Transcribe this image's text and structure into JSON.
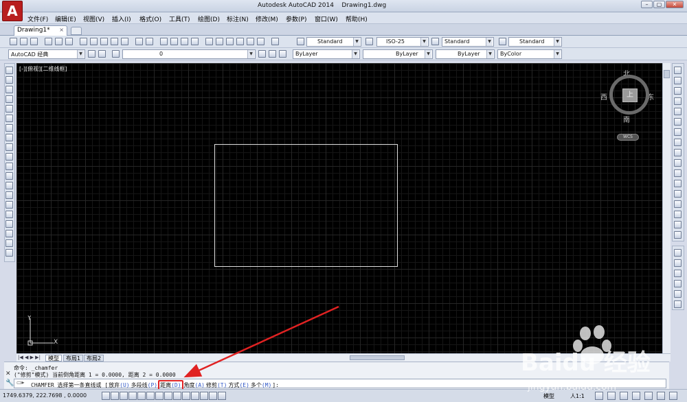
{
  "title": {
    "app": "Autodesk AutoCAD 2014",
    "file": "Drawing1.dwg"
  },
  "menu": [
    "文件(F)",
    "编辑(E)",
    "视图(V)",
    "插入(I)",
    "格式(O)",
    "工具(T)",
    "绘图(D)",
    "标注(N)",
    "修改(M)",
    "参数(P)",
    "窗口(W)",
    "帮助(H)"
  ],
  "doc_tab": {
    "label": "Drawing1*",
    "close": "×"
  },
  "styles": {
    "text_style": "Standard",
    "dim_style": "ISO-25",
    "table_style": "Standard",
    "mleader_style": "Standard"
  },
  "workspace": "AutoCAD 经典",
  "layer": {
    "current": "0"
  },
  "properties": {
    "color": "ByLayer",
    "linetype": "ByLayer",
    "lineweight": "ByLayer",
    "plotstyle": "ByColor"
  },
  "viewport_label": "[-][俯视][二维线框]",
  "viewcube": {
    "north": "北",
    "south": "南",
    "east": "东",
    "west": "西",
    "top": "上",
    "wcs": "WCS"
  },
  "ucs": {
    "x": "X",
    "y": "Y"
  },
  "layout_tabs": [
    "模型",
    "布局1",
    "布局2"
  ],
  "command": {
    "line1": "命令: _chamfer",
    "line2": "(\"修剪\"模式) 当前倒角距离 1 = 0.0000, 距离 2 = 0.0000",
    "prompt": "CHAMFER 选择第一条直线或",
    "options": [
      {
        "label": "放弃",
        "key": "(U)"
      },
      {
        "label": "多段线",
        "key": "(P)"
      },
      {
        "label": "距离",
        "key": "(D)"
      },
      {
        "label": "角度",
        "key": "(A)"
      },
      {
        "label": "修剪",
        "key": "(T)"
      },
      {
        "label": "方式",
        "key": "(E)"
      },
      {
        "label": "多个",
        "key": "(M)"
      }
    ],
    "suffix": "]:"
  },
  "status": {
    "coords": "1749.6379, 222.7698 , 0.0000",
    "model": "模型",
    "scale": "人1:1"
  },
  "watermark": {
    "brand": "Baidu 经验",
    "url": "jingyan.baidu.com"
  },
  "colors": {
    "highlight": "#e02222",
    "arrow": "#e02222",
    "canvas": "#000000"
  }
}
